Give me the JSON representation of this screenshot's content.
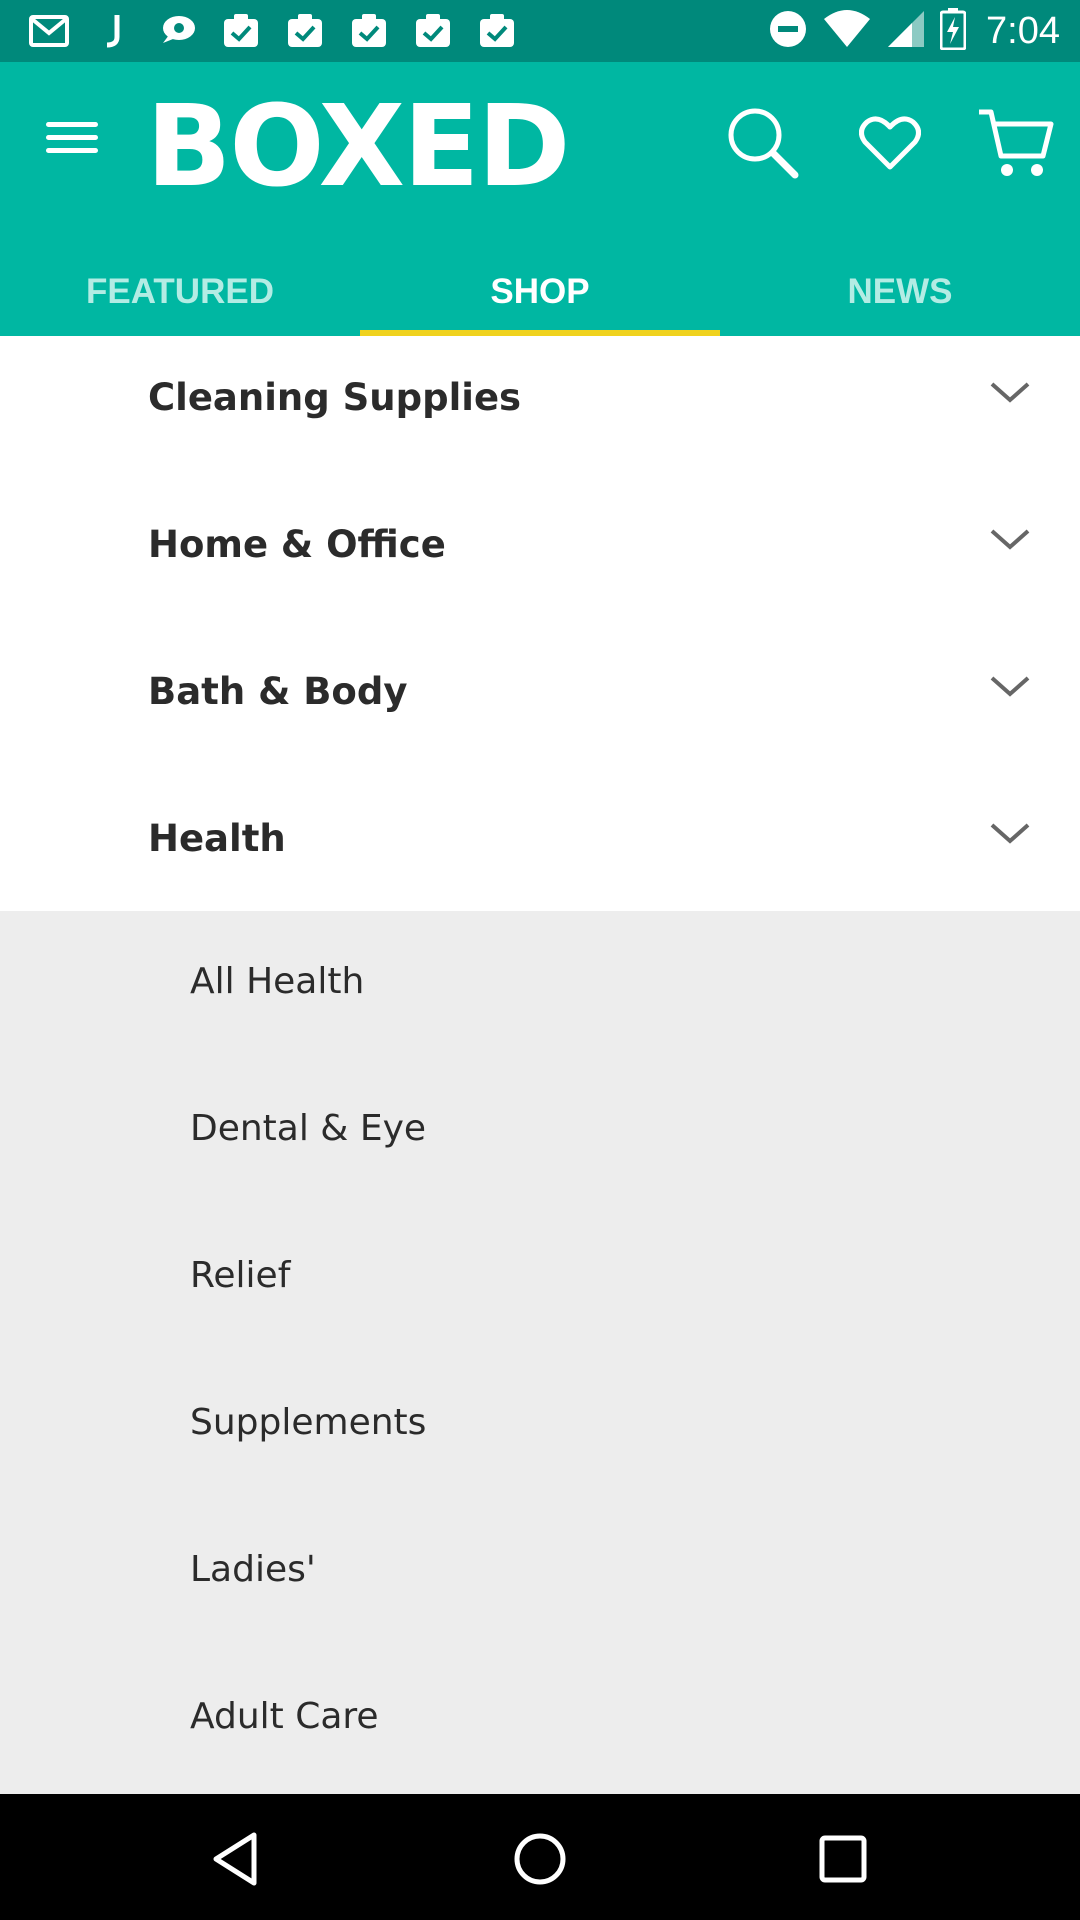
{
  "status_bar": {
    "time": "7:04",
    "left_icons": [
      "gmail-icon",
      "j-app-icon",
      "chat-icon",
      "task-icon",
      "task-icon",
      "task-icon",
      "task-icon",
      "task-icon"
    ],
    "right_icons": [
      "do-not-disturb-icon",
      "wifi-icon",
      "signal-icon",
      "battery-charging-icon"
    ]
  },
  "header": {
    "logo_text": "BOXED",
    "accent_color": "#00b7a2",
    "tab_indicator_color": "#f0d21e"
  },
  "tabs": [
    {
      "label": "FEATURED",
      "active": false
    },
    {
      "label": "SHOP",
      "active": true
    },
    {
      "label": "NEWS",
      "active": false
    }
  ],
  "categories": [
    {
      "label": "Cleaning Supplies"
    },
    {
      "label": "Home & Office"
    },
    {
      "label": "Bath & Body"
    },
    {
      "label": "Health"
    }
  ],
  "health_subcategories": [
    {
      "label": "All Health"
    },
    {
      "label": "Dental & Eye"
    },
    {
      "label": "Relief"
    },
    {
      "label": "Supplements"
    },
    {
      "label": "Ladies'"
    },
    {
      "label": "Adult Care"
    }
  ]
}
